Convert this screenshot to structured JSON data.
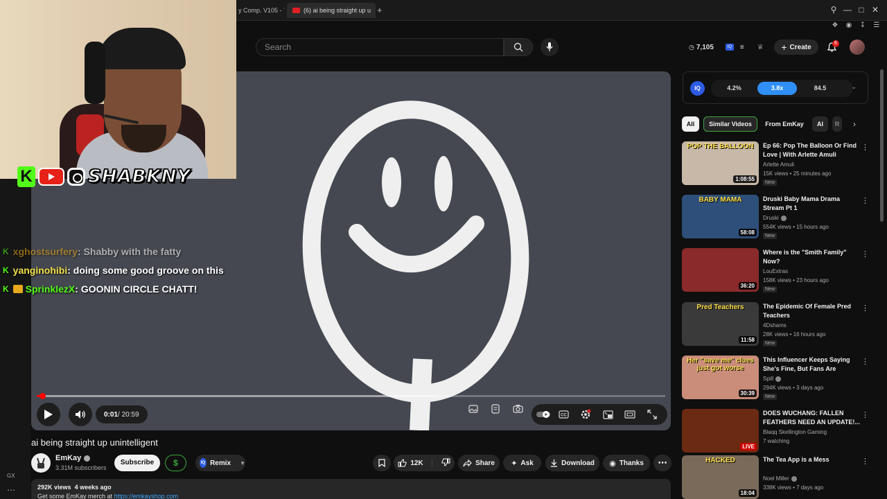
{
  "browser": {
    "tabs": [
      {
        "label": "y Comp. V105 - Y"
      },
      {
        "label": "(6) ai being straight up u"
      }
    ]
  },
  "header": {
    "search_placeholder": "Search",
    "counter": "7,105",
    "iq_label": "IQ",
    "create_label": "Create",
    "notifications": "6"
  },
  "webcam": {
    "handle": "SHABKNY"
  },
  "chat": [
    {
      "user": "xghostsurfery",
      "message": " : Shabby with the fatty",
      "user_color": "#e9a91c",
      "faded": true
    },
    {
      "user": "yanginohibi",
      "message": " : doing some good groove on this",
      "user_color": "#f1e04a",
      "faded": false
    },
    {
      "user": "SprinklezX",
      "message": " : GOONIN CIRCLE CHATT!",
      "user_color": "#53fc18",
      "faded": false
    }
  ],
  "player": {
    "time_current": "0:01",
    "time_total": " / 20:59",
    "progress_fraction": 0.0008
  },
  "video": {
    "title": "ai being straight up unintelligent",
    "channel": "EmKay",
    "subscribers": "3.31M subscribers",
    "subscribe_label": "Subscribe",
    "dollar_label": "$",
    "remix_label": "Remix",
    "likes": "12K",
    "share_label": "Share",
    "ask_label": "Ask",
    "download_label": "Download",
    "thanks_label": "Thanks",
    "views": "292K views",
    "age": "4 weeks ago",
    "desc_line": "Get some EmKay merch at",
    "desc_link": "https://emkayshop.com"
  },
  "iq_panel": {
    "badge": "IQ",
    "values": [
      "4.2%",
      "3.8x",
      "84.5"
    ],
    "active_index": 1
  },
  "chips": [
    "All",
    "Similar Videos",
    "From EmKay",
    "AI",
    "R"
  ],
  "recommendations": [
    {
      "title": "Ep 66: Pop The Balloon Or Find Love | With Arlette Amuli",
      "channel": "Arlette Amuli",
      "meta": "15K views • 25 minutes ago",
      "badge": "New",
      "duration": "1:08:55",
      "thumb_text": "POP THE BALLOON",
      "thumb_bg": "#c7b8a8",
      "verified": false,
      "live": false
    },
    {
      "title": "Druski Baby Mama Drama Stream Pt 1",
      "channel": "Druski",
      "meta": "554K views • 15 hours ago",
      "badge": "New",
      "duration": "58:08",
      "thumb_text": "BABY MAMA",
      "thumb_bg": "#2e4f7a",
      "verified": true,
      "live": false
    },
    {
      "title": "Where is the \"Smith Family\" Now?",
      "channel": "LouExtras",
      "meta": "158K views • 23 hours ago",
      "badge": "New",
      "duration": "36:20",
      "thumb_text": "",
      "thumb_bg": "#8a2a2a",
      "verified": false,
      "live": false
    },
    {
      "title": "The Epidemic Of Female Pred Teachers",
      "channel": "4Dshams",
      "meta": "28K views • 16 hours ago",
      "badge": "New",
      "duration": "11:58",
      "thumb_text": "Pred Teachers",
      "thumb_bg": "#3a3a3a",
      "verified": false,
      "live": false
    },
    {
      "title": "This Influencer Keeps Saying She's Fine, But Fans Are Findin...",
      "channel": "Spill",
      "meta": "294K views • 3 days ago",
      "badge": "New",
      "duration": "30:39",
      "thumb_text": "Her \"save me\" clues just got worse",
      "thumb_bg": "#c98d7a",
      "verified": true,
      "live": false
    },
    {
      "title": "DOES WUCHANG: FALLEN FEATHERS NEED AN UPDATE!...",
      "channel": "Blaqq Skellington Gaming",
      "meta": "7 watching",
      "badge": "",
      "duration": "LIVE",
      "thumb_text": "",
      "thumb_bg": "#6b2a12",
      "verified": false,
      "live": true
    },
    {
      "title": "The Tea App is a Mess",
      "channel": "Noel Miller",
      "meta": "338K views • 7 days ago",
      "badge": "",
      "duration": "18:04",
      "thumb_text": "HACKED",
      "thumb_bg": "#7a6a5a",
      "verified": true,
      "live": false
    }
  ],
  "sidebar": {
    "gx_label": "GX"
  }
}
